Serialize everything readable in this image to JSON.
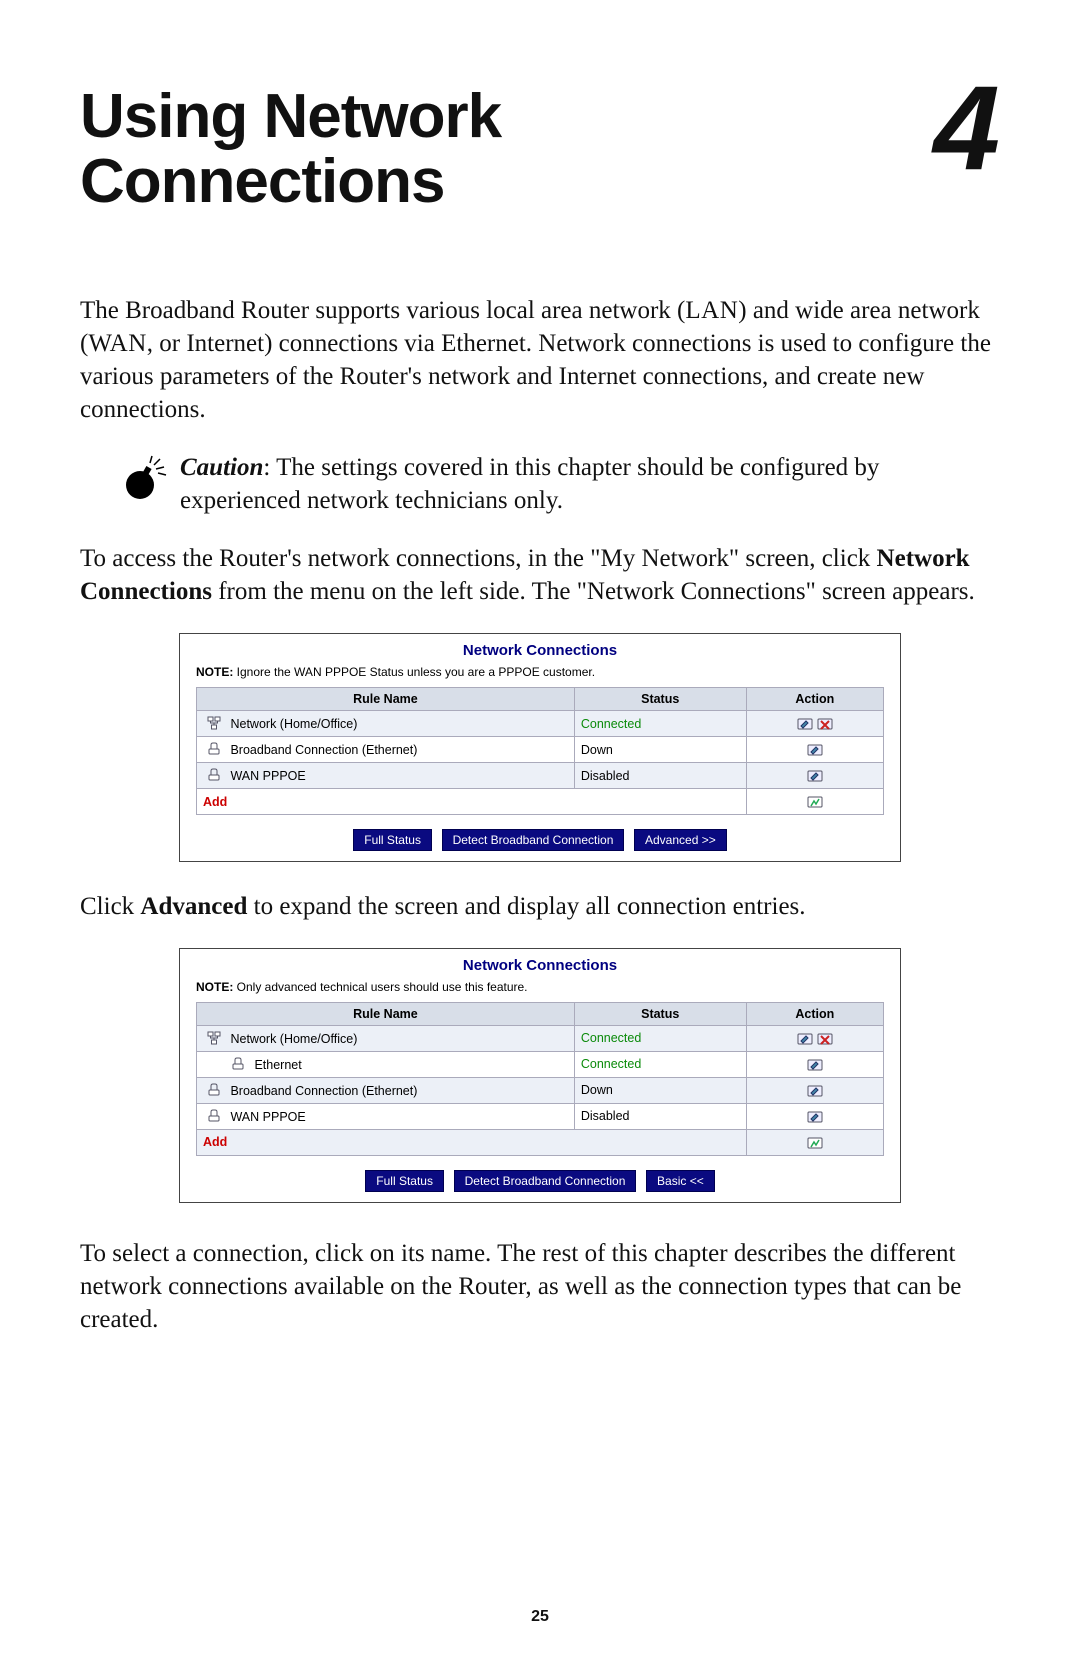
{
  "chapter": {
    "title_line1": "Using Network",
    "title_line2": "Connections",
    "number": "4"
  },
  "para1_a": "The Broadband Router supports various local area network (",
  "para1_lan": "LAN",
  "para1_b": ") and wide area network (",
  "para1_wan": "WAN",
  "para1_c": ", or Internet) connections via Ethernet. Network connections is used to configure the various parameters of the Router's network and Internet connections, and create new connections.",
  "caution_label": "Caution",
  "caution_text": ": The settings covered in this chapter should be configured by experienced network technicians only.",
  "para2_a": "To access the Router's network connections, in the \"My Network\" screen, click ",
  "para2_bold": "Network Connections",
  "para2_b": " from the menu on the left side. The \"Network Connections\" screen appears.",
  "screenshot1": {
    "title": "Network Connections",
    "note_bold": "NOTE:",
    "note_rest": " Ignore the WAN PPPOE Status unless you are a PPPOE customer.",
    "headers": {
      "rule": "Rule Name",
      "status": "Status",
      "action": "Action"
    },
    "rows": [
      {
        "name": "Network (Home/Office)",
        "status": "Connected",
        "status_class": "status-connected",
        "icons": 2,
        "indent": false,
        "icon": "lan"
      },
      {
        "name": "Broadband Connection (Ethernet)",
        "status": "Down",
        "status_class": "",
        "icons": 1,
        "indent": false,
        "icon": "eth"
      },
      {
        "name": "WAN PPPOE",
        "status": "Disabled",
        "status_class": "",
        "icons": 1,
        "indent": false,
        "icon": "eth"
      }
    ],
    "add_label": "Add",
    "buttons": [
      "Full Status",
      "Detect Broadband Connection",
      "Advanced >>"
    ]
  },
  "para3_a": "Click ",
  "para3_bold": "Advanced",
  "para3_b": " to expand the screen and display all connection entries.",
  "screenshot2": {
    "title": "Network Connections",
    "note_bold": "NOTE:",
    "note_rest": " Only advanced technical users should use this feature.",
    "headers": {
      "rule": "Rule Name",
      "status": "Status",
      "action": "Action"
    },
    "rows": [
      {
        "name": "Network (Home/Office)",
        "status": "Connected",
        "status_class": "status-connected",
        "icons": 2,
        "indent": false,
        "icon": "lan"
      },
      {
        "name": "Ethernet",
        "status": "Connected",
        "status_class": "status-connected",
        "icons": 1,
        "indent": true,
        "icon": "eth"
      },
      {
        "name": "Broadband Connection (Ethernet)",
        "status": "Down",
        "status_class": "",
        "icons": 1,
        "indent": false,
        "icon": "eth"
      },
      {
        "name": "WAN PPPOE",
        "status": "Disabled",
        "status_class": "",
        "icons": 1,
        "indent": false,
        "icon": "eth"
      }
    ],
    "add_label": "Add",
    "buttons": [
      "Full  Status",
      "Detect Broadband Connection",
      "Basic <<"
    ]
  },
  "para4": "To select a connection, click on its name. The rest of this chapter describes the different network connections available on the Router, as well as the connection types that can be created.",
  "page_number": "25"
}
